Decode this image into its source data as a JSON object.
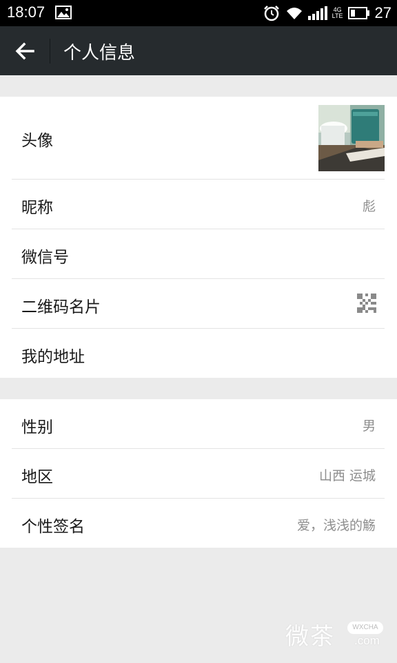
{
  "status_bar": {
    "time": "18:07",
    "network_label": "4G",
    "network_sub": "LTE",
    "battery": "27"
  },
  "app_bar": {
    "title": "个人信息",
    "back_icon": "arrow-left-icon"
  },
  "section1": {
    "rows": [
      {
        "label": "头像",
        "value": ""
      },
      {
        "label": "昵称",
        "value": "彪"
      },
      {
        "label": "微信号",
        "value": ""
      },
      {
        "label": "二维码名片",
        "value": ""
      },
      {
        "label": "我的地址",
        "value": ""
      }
    ]
  },
  "section2": {
    "rows": [
      {
        "label": "性别",
        "value": "男"
      },
      {
        "label": "地区",
        "value": "山西 运城"
      },
      {
        "label": "个性签名",
        "value": "爱，浅浅的觞"
      }
    ]
  },
  "watermark": {
    "text": "微茶",
    "badge": "WXCHA",
    "domain": ".com"
  },
  "colors": {
    "app_bar": "#262b2e",
    "page_bg": "#ebebeb",
    "value_text": "#8e8e8e"
  }
}
